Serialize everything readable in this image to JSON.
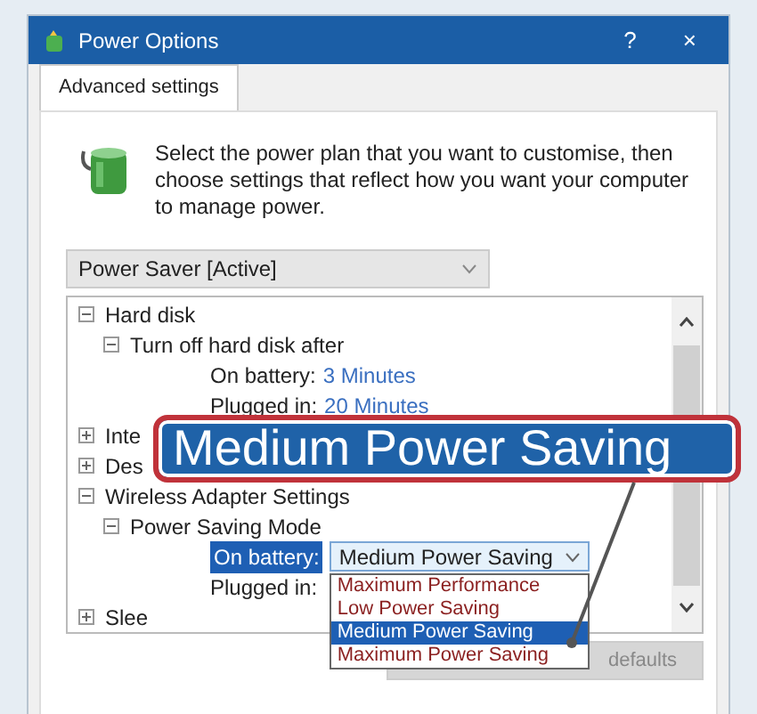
{
  "window": {
    "title": "Power Options",
    "help": "?",
    "close": "×"
  },
  "tabs": [
    {
      "label": "Advanced settings",
      "selected": true
    }
  ],
  "intro": "Select the power plan that you want to customise, then choose settings that reflect how you want your computer to manage power.",
  "plan": {
    "value": "Power Saver [Active]"
  },
  "tree": [
    {
      "label": "Hard disk",
      "expanded": true,
      "children": [
        {
          "label": "Turn off hard disk after",
          "expanded": true,
          "settings": [
            {
              "label": "On battery:",
              "value": "3 Minutes",
              "kind": "text",
              "selected": false
            },
            {
              "label": "Plugged in:",
              "value": "20 Minutes",
              "kind": "text",
              "selected": false
            }
          ]
        }
      ]
    },
    {
      "label": "Inte",
      "expanded": false
    },
    {
      "label": "Des",
      "expanded": false
    },
    {
      "label": "Wireless Adapter Settings",
      "expanded": true,
      "children": [
        {
          "label": "Power Saving Mode",
          "expanded": true,
          "settings": [
            {
              "label": "On battery:",
              "value": "Medium Power Saving",
              "kind": "dropdown",
              "selected": true
            },
            {
              "label": "Plugged in:",
              "kind": "text",
              "selected": false
            }
          ]
        }
      ]
    },
    {
      "label": "Slee",
      "expanded": false
    }
  ],
  "dropdown_options": [
    {
      "label": "Maximum Performance",
      "selected": false
    },
    {
      "label": "Low Power Saving",
      "selected": false
    },
    {
      "label": "Medium Power Saving",
      "selected": true
    },
    {
      "label": "Maximum Power Saving",
      "selected": false
    }
  ],
  "restore_button": "defaults",
  "callout": "Medium Power Saving"
}
